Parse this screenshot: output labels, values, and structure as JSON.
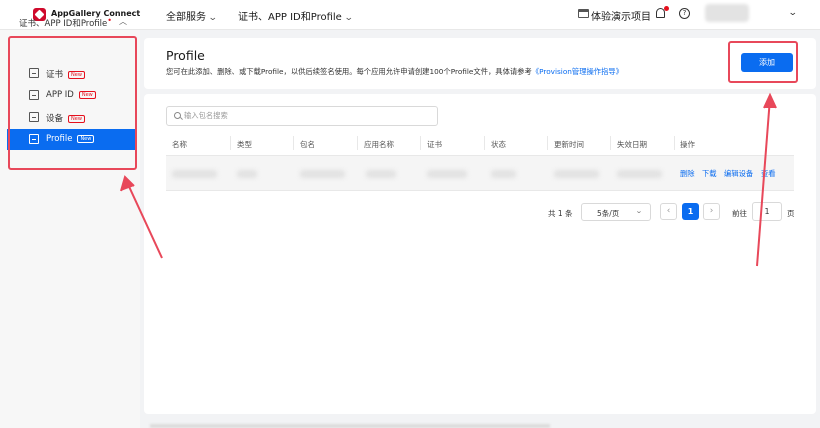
{
  "topbar": {
    "brand": "AppGallery Connect",
    "nav_all_services": "全部服务",
    "nav_cert": "证书、APP ID和Profile",
    "demo_project": "体验演示项目",
    "help_glyph": "?"
  },
  "sidebar": {
    "group_label": "证书、APP ID和Profile",
    "required_mark": "•",
    "items": [
      {
        "label": "证书",
        "badge": "New"
      },
      {
        "label": "APP ID",
        "badge": "New"
      },
      {
        "label": "设备",
        "badge": "New"
      },
      {
        "label": "Profile",
        "badge": "New",
        "active": true
      }
    ]
  },
  "header": {
    "title": "Profile",
    "description": "您可在此添加、删除、或下载Profile，以供后续签名使用。每个应用允许申请创建100个Profile文件，具体请参考",
    "link_text": "《Provision管理操作指导》",
    "add_button": "添加"
  },
  "search": {
    "placeholder": "输入包名搜索"
  },
  "table": {
    "columns": [
      "名称",
      "类型",
      "包名",
      "应用名称",
      "证书",
      "状态",
      "更新时间",
      "失效日期",
      "操作"
    ],
    "row_actions": [
      "删除",
      "下载",
      "编辑设备",
      "查看"
    ]
  },
  "pagination": {
    "total": "共 1 条",
    "page_size": "5条/页",
    "prev": "‹",
    "current_page": "1",
    "next": "›",
    "goto_label": "前往",
    "goto_value": "1",
    "page_unit": "页"
  },
  "colors": {
    "accent": "#0a6cf0",
    "annotation": "#e8485a",
    "brand_red": "#cf0a2c"
  }
}
